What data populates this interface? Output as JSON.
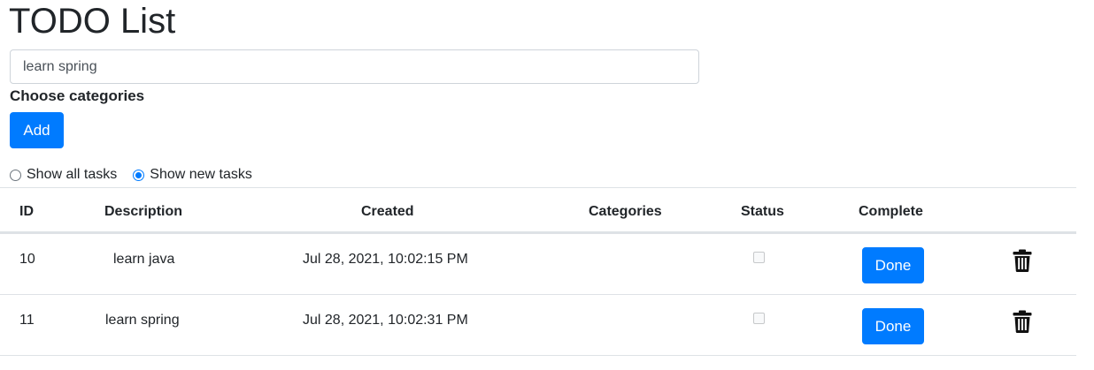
{
  "header": {
    "title": "TODO List"
  },
  "form": {
    "input_value": "learn spring",
    "categories_label": "Choose categories",
    "add_label": "Add"
  },
  "filters": {
    "show_all_label": "Show all tasks",
    "show_new_label": "Show new tasks",
    "selected": "show_new"
  },
  "table": {
    "headers": {
      "id": "ID",
      "description": "Description",
      "created": "Created",
      "categories": "Categories",
      "status": "Status",
      "complete": "Complete"
    },
    "rows": [
      {
        "id": "10",
        "description": "learn java",
        "created": "Jul 28, 2021, 10:02:15 PM",
        "categories": "",
        "status_checked": false,
        "done_label": "Done"
      },
      {
        "id": "11",
        "description": "learn spring",
        "created": "Jul 28, 2021, 10:02:31 PM",
        "categories": "",
        "status_checked": false,
        "done_label": "Done"
      }
    ]
  },
  "colors": {
    "primary": "#007bff",
    "text": "#212529",
    "border": "#dee2e6"
  },
  "icons": {
    "delete": "trash-icon"
  }
}
